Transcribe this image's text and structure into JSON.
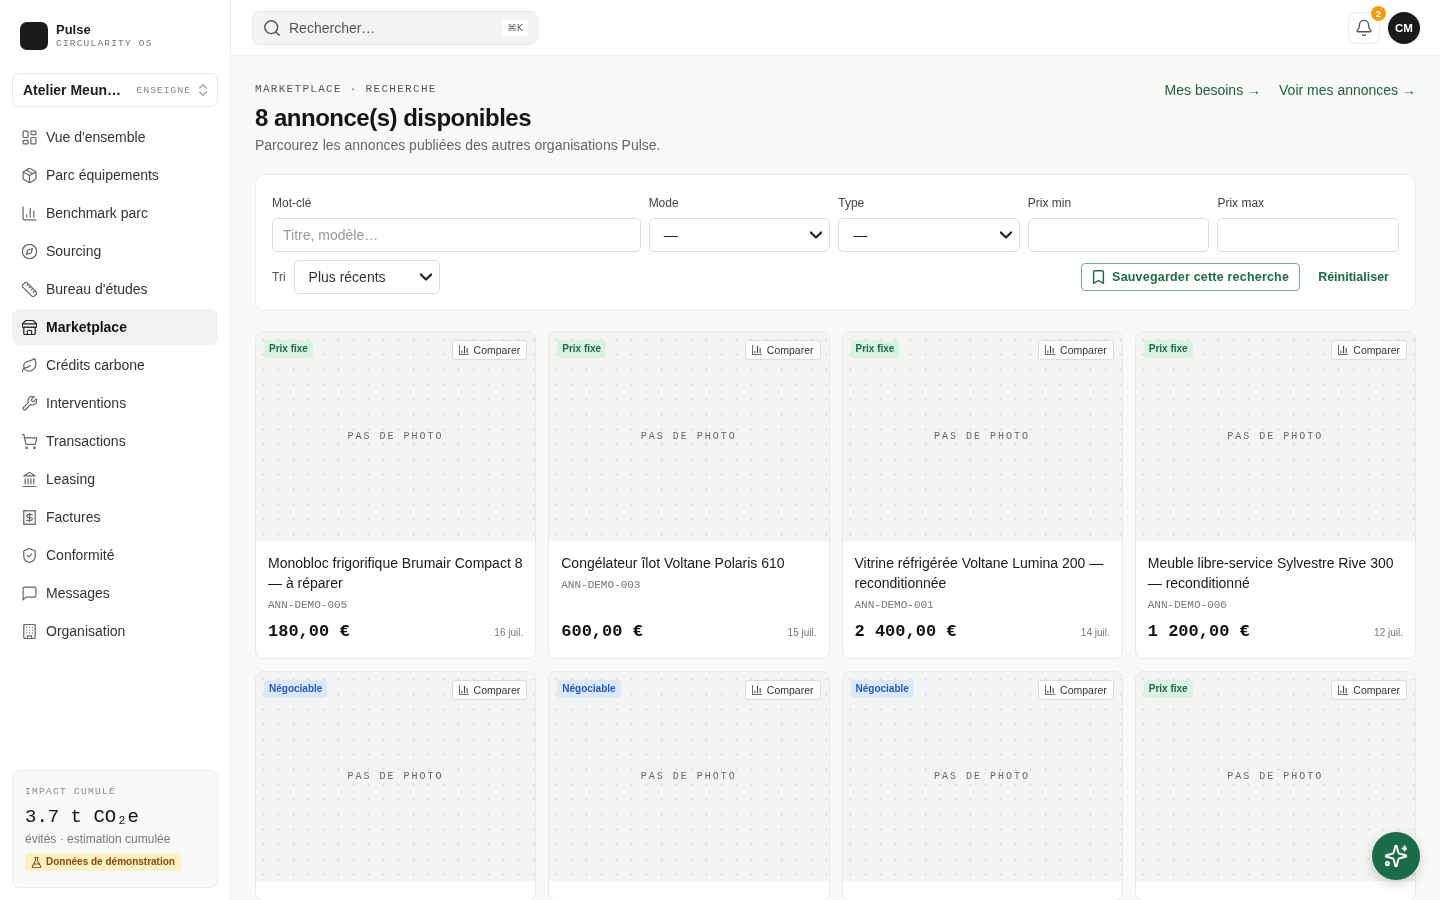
{
  "sidebar": {
    "brand": {
      "name": "Pulse",
      "tagline": "CIRCULARITY OS"
    },
    "org": {
      "name": "Atelier Meun…",
      "role": "ENSEIGNE"
    },
    "nav": [
      {
        "label": "Vue d'ensemble",
        "selected": false
      },
      {
        "label": "Parc équipements",
        "selected": false
      },
      {
        "label": "Benchmark parc",
        "selected": false
      },
      {
        "label": "Sourcing",
        "selected": false
      },
      {
        "label": "Bureau d'études",
        "selected": false
      },
      {
        "label": "Marketplace",
        "selected": true
      },
      {
        "label": "Crédits carbone",
        "selected": false
      },
      {
        "label": "Interventions",
        "selected": false
      },
      {
        "label": "Transactions",
        "selected": false
      },
      {
        "label": "Leasing",
        "selected": false
      },
      {
        "label": "Factures",
        "selected": false
      },
      {
        "label": "Conformité",
        "selected": false
      },
      {
        "label": "Messages",
        "selected": false
      },
      {
        "label": "Organisation",
        "selected": false
      }
    ],
    "impact": {
      "label": "IMPACT CUMULÉ",
      "value": "3.7 t CO₂e",
      "note": "évités · estimation cumulée",
      "badge": "Données de démonstration"
    }
  },
  "header": {
    "search": {
      "placeholder": "Rechercher…",
      "shortcut": "⌘K"
    },
    "notifications": {
      "count": "2"
    },
    "avatar": {
      "initials": "CM"
    }
  },
  "page": {
    "breadcrumb": "MARKETPLACE · RECHERCHE",
    "title": "8 annonce(s) disponibles",
    "subtitle": "Parcourez les annonces publiées des autres organisations Pulse.",
    "links": [
      "Mes besoins →",
      "Voir mes annonces →"
    ]
  },
  "filters": {
    "fields": [
      {
        "label": "Mot-clé",
        "kind": "text",
        "placeholder": "Titre, modèle…"
      },
      {
        "label": "Mode",
        "kind": "select",
        "value": "—"
      },
      {
        "label": "Type",
        "kind": "select",
        "value": "—"
      },
      {
        "label": "Prix min",
        "kind": "text"
      },
      {
        "label": "Prix max",
        "kind": "text"
      }
    ],
    "sort": {
      "label": "Tri",
      "value": "Plus récents"
    },
    "save_button": "Sauvegarder cette recherche",
    "reset_link": "Réinitialiser"
  },
  "listings": [
    {
      "badge": "Prix fixe",
      "kind": "fixed",
      "compare": "Comparer",
      "photo_label": "PAS DE PHOTO",
      "title": "Monobloc frigorifique Brumair Compact 8 — à réparer",
      "code": "ANN-DEMO-005",
      "price": "180,00 €",
      "date": "16 juil."
    },
    {
      "badge": "Prix fixe",
      "kind": "fixed",
      "compare": "Comparer",
      "photo_label": "PAS DE PHOTO",
      "title": "Congélateur îlot Voltane Polaris 610",
      "code": "ANN-DEMO-003",
      "price": "600,00 €",
      "date": "15 juil."
    },
    {
      "badge": "Prix fixe",
      "kind": "fixed",
      "compare": "Comparer",
      "photo_label": "PAS DE PHOTO",
      "title": "Vitrine réfrigérée Voltane Lumina 200 — reconditionnée",
      "code": "ANN-DEMO-001",
      "price": "2 400,00 €",
      "date": "14 juil."
    },
    {
      "badge": "Prix fixe",
      "kind": "fixed",
      "compare": "Comparer",
      "photo_label": "PAS DE PHOTO",
      "title": "Meuble libre-service Sylvestre Rive 300 — reconditionné",
      "code": "ANN-DEMO-006",
      "price": "1 200,00 €",
      "date": "12 juil."
    },
    {
      "badge": "Négociable",
      "kind": "negotiable",
      "compare": "Comparer",
      "photo_label": "PAS DE PHOTO"
    },
    {
      "badge": "Négociable",
      "kind": "negotiable",
      "compare": "Comparer",
      "photo_label": "PAS DE PHOTO"
    },
    {
      "badge": "Négociable",
      "kind": "negotiable",
      "compare": "Comparer",
      "photo_label": "PAS DE PHOTO"
    },
    {
      "badge": "Prix fixe",
      "kind": "fixed",
      "compare": "Comparer",
      "photo_label": "PAS DE PHOTO"
    }
  ]
}
